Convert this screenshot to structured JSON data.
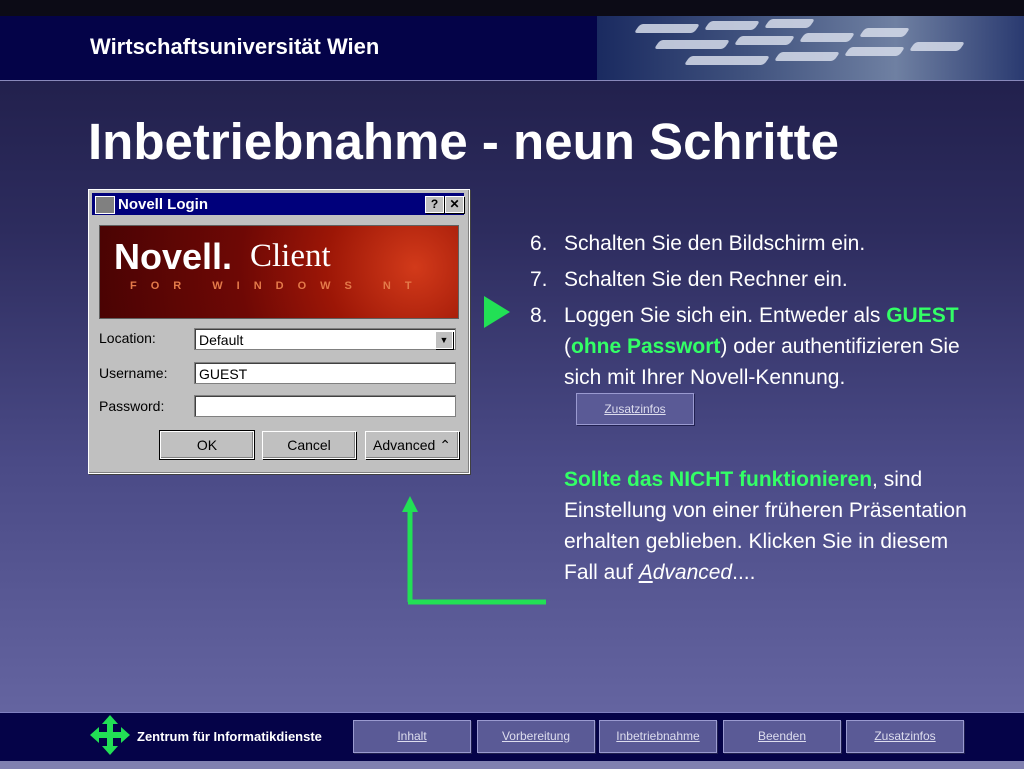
{
  "header": {
    "university": "Wirtschaftsuniversität Wien"
  },
  "title": "Inbetriebnahme - neun Schritte",
  "dialog": {
    "title": "Novell Login",
    "help_btn": "?",
    "close_btn": "✕",
    "banner_brand": "Novell.",
    "banner_client": "Client",
    "banner_sub": "FOR WINDOWS NT",
    "location_label": "Location:",
    "location_value": "Default",
    "username_label": "Username:",
    "username_value": "GUEST",
    "password_label": "Password:",
    "password_value": "",
    "ok_label": "OK",
    "cancel_label": "Cancel",
    "advanced_label": "Advanced"
  },
  "steps": [
    {
      "num": "6.",
      "text": "Schalten Sie den Bildschirm ein."
    },
    {
      "num": "7.",
      "text": "Schalten Sie den Rechner ein."
    },
    {
      "num": "8.",
      "pre": "Loggen Sie sich ein. Entweder als ",
      "guest": "GUEST",
      "open": " (",
      "nopass": "ohne Passwort",
      "post": ") oder authentifizieren Sie sich mit Ihrer Novell-Kennung."
    }
  ],
  "zusatzinfos_inline": "Zusatzinfos",
  "warning": {
    "bold": "Sollte das NICHT funktionieren",
    "text": ", sind Einstellung von einer früheren Präsentation erhalten geblieben. Klicken Sie in diesem Fall auf ",
    "adv_A": "A",
    "adv_rest": "dvanced",
    "ellipsis": "...."
  },
  "footer": {
    "org": "Zentrum für Informatikdienste",
    "nav": [
      "Inhalt",
      "Vorbereitung",
      "Inbetriebnahme",
      "Beenden",
      "Zusatzinfos"
    ]
  },
  "colors": {
    "accent_green": "#33ff66",
    "header_bg": "#040348",
    "title_bar": "#00007b"
  }
}
